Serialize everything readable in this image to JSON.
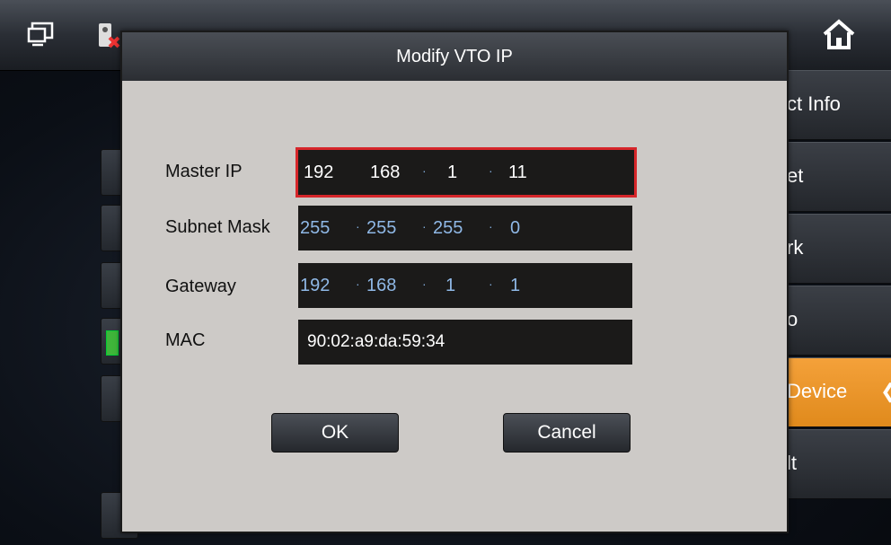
{
  "dialog": {
    "title": "Modify VTO IP",
    "fields": {
      "master_ip": {
        "label": "Master IP",
        "octets": [
          "192",
          "168",
          "1",
          "11"
        ]
      },
      "subnet_mask": {
        "label": "Subnet Mask",
        "octets": [
          "255",
          "255",
          "255",
          "0"
        ]
      },
      "gateway": {
        "label": "Gateway",
        "octets": [
          "192",
          "168",
          "1",
          "1"
        ]
      },
      "mac": {
        "label": "MAC",
        "value": "90:02:a9:da:59:34"
      }
    },
    "ok_label": "OK",
    "cancel_label": "Cancel"
  },
  "menu": {
    "items": [
      {
        "label": "ct Info"
      },
      {
        "label": "et"
      },
      {
        "label": "rk"
      },
      {
        "label": "o"
      },
      {
        "label": "Device",
        "active": true
      },
      {
        "label": "lt"
      }
    ]
  },
  "icons": {
    "top_left": "monitor-icon",
    "top_second": "device-offline-icon",
    "top_right": "home-icon"
  },
  "colors": {
    "selected_border": "#d6262a",
    "active_menu": "#f4a13a",
    "octet_text_editable": "#8fb8e6"
  }
}
